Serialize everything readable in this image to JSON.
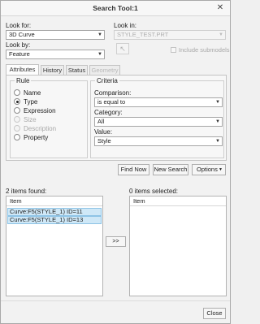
{
  "window": {
    "title": "Search Tool:1"
  },
  "look_for": {
    "label": "Look for:",
    "value": "3D Curve"
  },
  "look_in": {
    "label": "Look in:",
    "value": "STYLE_TEST.PRT"
  },
  "look_by": {
    "label": "Look by:",
    "value": "Feature"
  },
  "include_submodels": {
    "label": "Include submodels",
    "checked": false
  },
  "tabs": [
    {
      "label": "Attributes",
      "active": true
    },
    {
      "label": "History"
    },
    {
      "label": "Status"
    },
    {
      "label": "Geometry",
      "disabled": true
    }
  ],
  "rule": {
    "title": "Rule",
    "options": [
      {
        "label": "Name",
        "checked": false
      },
      {
        "label": "Type",
        "checked": true
      },
      {
        "label": "Expression",
        "checked": false
      },
      {
        "label": "Size",
        "disabled": true
      },
      {
        "label": "Description",
        "disabled": true
      },
      {
        "label": "Property",
        "checked": false
      }
    ]
  },
  "criteria": {
    "title": "Criteria",
    "comparison_label": "Comparison:",
    "comparison_value": "is equal to",
    "category_label": "Category:",
    "category_value": "All",
    "value_label": "Value:",
    "value_value": "Style"
  },
  "actions": {
    "find_now": "Find Now",
    "new_search": "New Search",
    "options": "Options"
  },
  "results": {
    "found_label": "2 items found:",
    "column": "Item",
    "items": [
      "Curve:F5(STYLE_1) ID=11",
      "Curve:F5(STYLE_1) ID=13"
    ]
  },
  "transfer_button": ">>",
  "selected": {
    "label": "0 items selected:",
    "column": "Item"
  },
  "close_button": "Close"
}
